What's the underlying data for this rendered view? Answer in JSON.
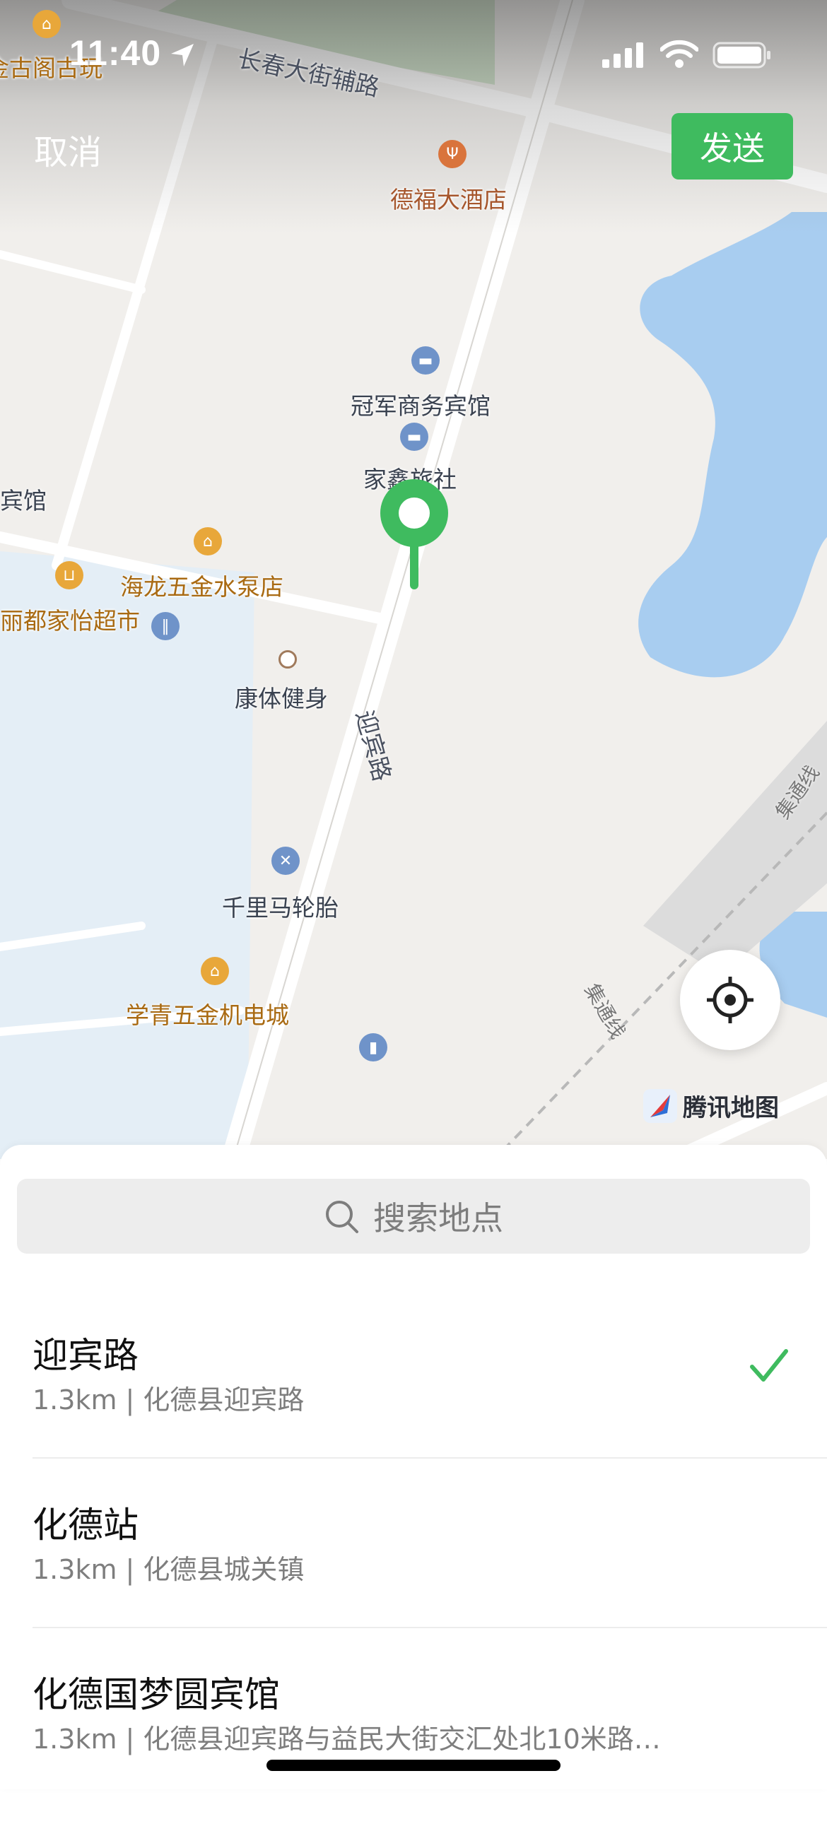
{
  "status_bar": {
    "time": "11:40",
    "icons": [
      "location-arrow-icon",
      "signal-icon",
      "wifi-icon",
      "battery-icon"
    ]
  },
  "header": {
    "cancel_label": "取消",
    "send_label": "发送",
    "send_color": "#3fbb5f"
  },
  "map": {
    "roads": [
      "长春大街辅路",
      "迎宾路",
      "集通线",
      "集通线"
    ],
    "pois": [
      {
        "name": "金古阁古玩",
        "icon": "shop-icon"
      },
      {
        "name": "德福大酒店",
        "icon": "restaurant-icon"
      },
      {
        "name": "冠军商务宾馆",
        "icon": "hotel-icon"
      },
      {
        "name": "家鑫旅社",
        "icon": "hotel-icon"
      },
      {
        "name": "宾馆",
        "icon": ""
      },
      {
        "name": "海龙五金水泵店",
        "icon": "shop-icon"
      },
      {
        "name": "丽都家怡超市",
        "icon": "cart-icon"
      },
      {
        "name": "康体健身",
        "icon": "dot-icon"
      },
      {
        "name": "千里马轮胎",
        "icon": "repair-icon"
      },
      {
        "name": "学青五金机电城",
        "icon": "shop-icon"
      }
    ],
    "provider": "腾讯地图",
    "pin_color": "#3fbb5f",
    "water_color": "#a8cdf0"
  },
  "search": {
    "placeholder": "搜索地点"
  },
  "results": [
    {
      "title": "迎宾路",
      "subtitle": "1.3km | 化德县迎宾路",
      "selected": true
    },
    {
      "title": "化德站",
      "subtitle": "1.3km | 化德县城关镇",
      "selected": false
    },
    {
      "title": "化德国梦圆宾馆",
      "subtitle": "1.3km | 化德县迎宾路与益民大街交汇处北10米路…",
      "selected": false
    }
  ]
}
